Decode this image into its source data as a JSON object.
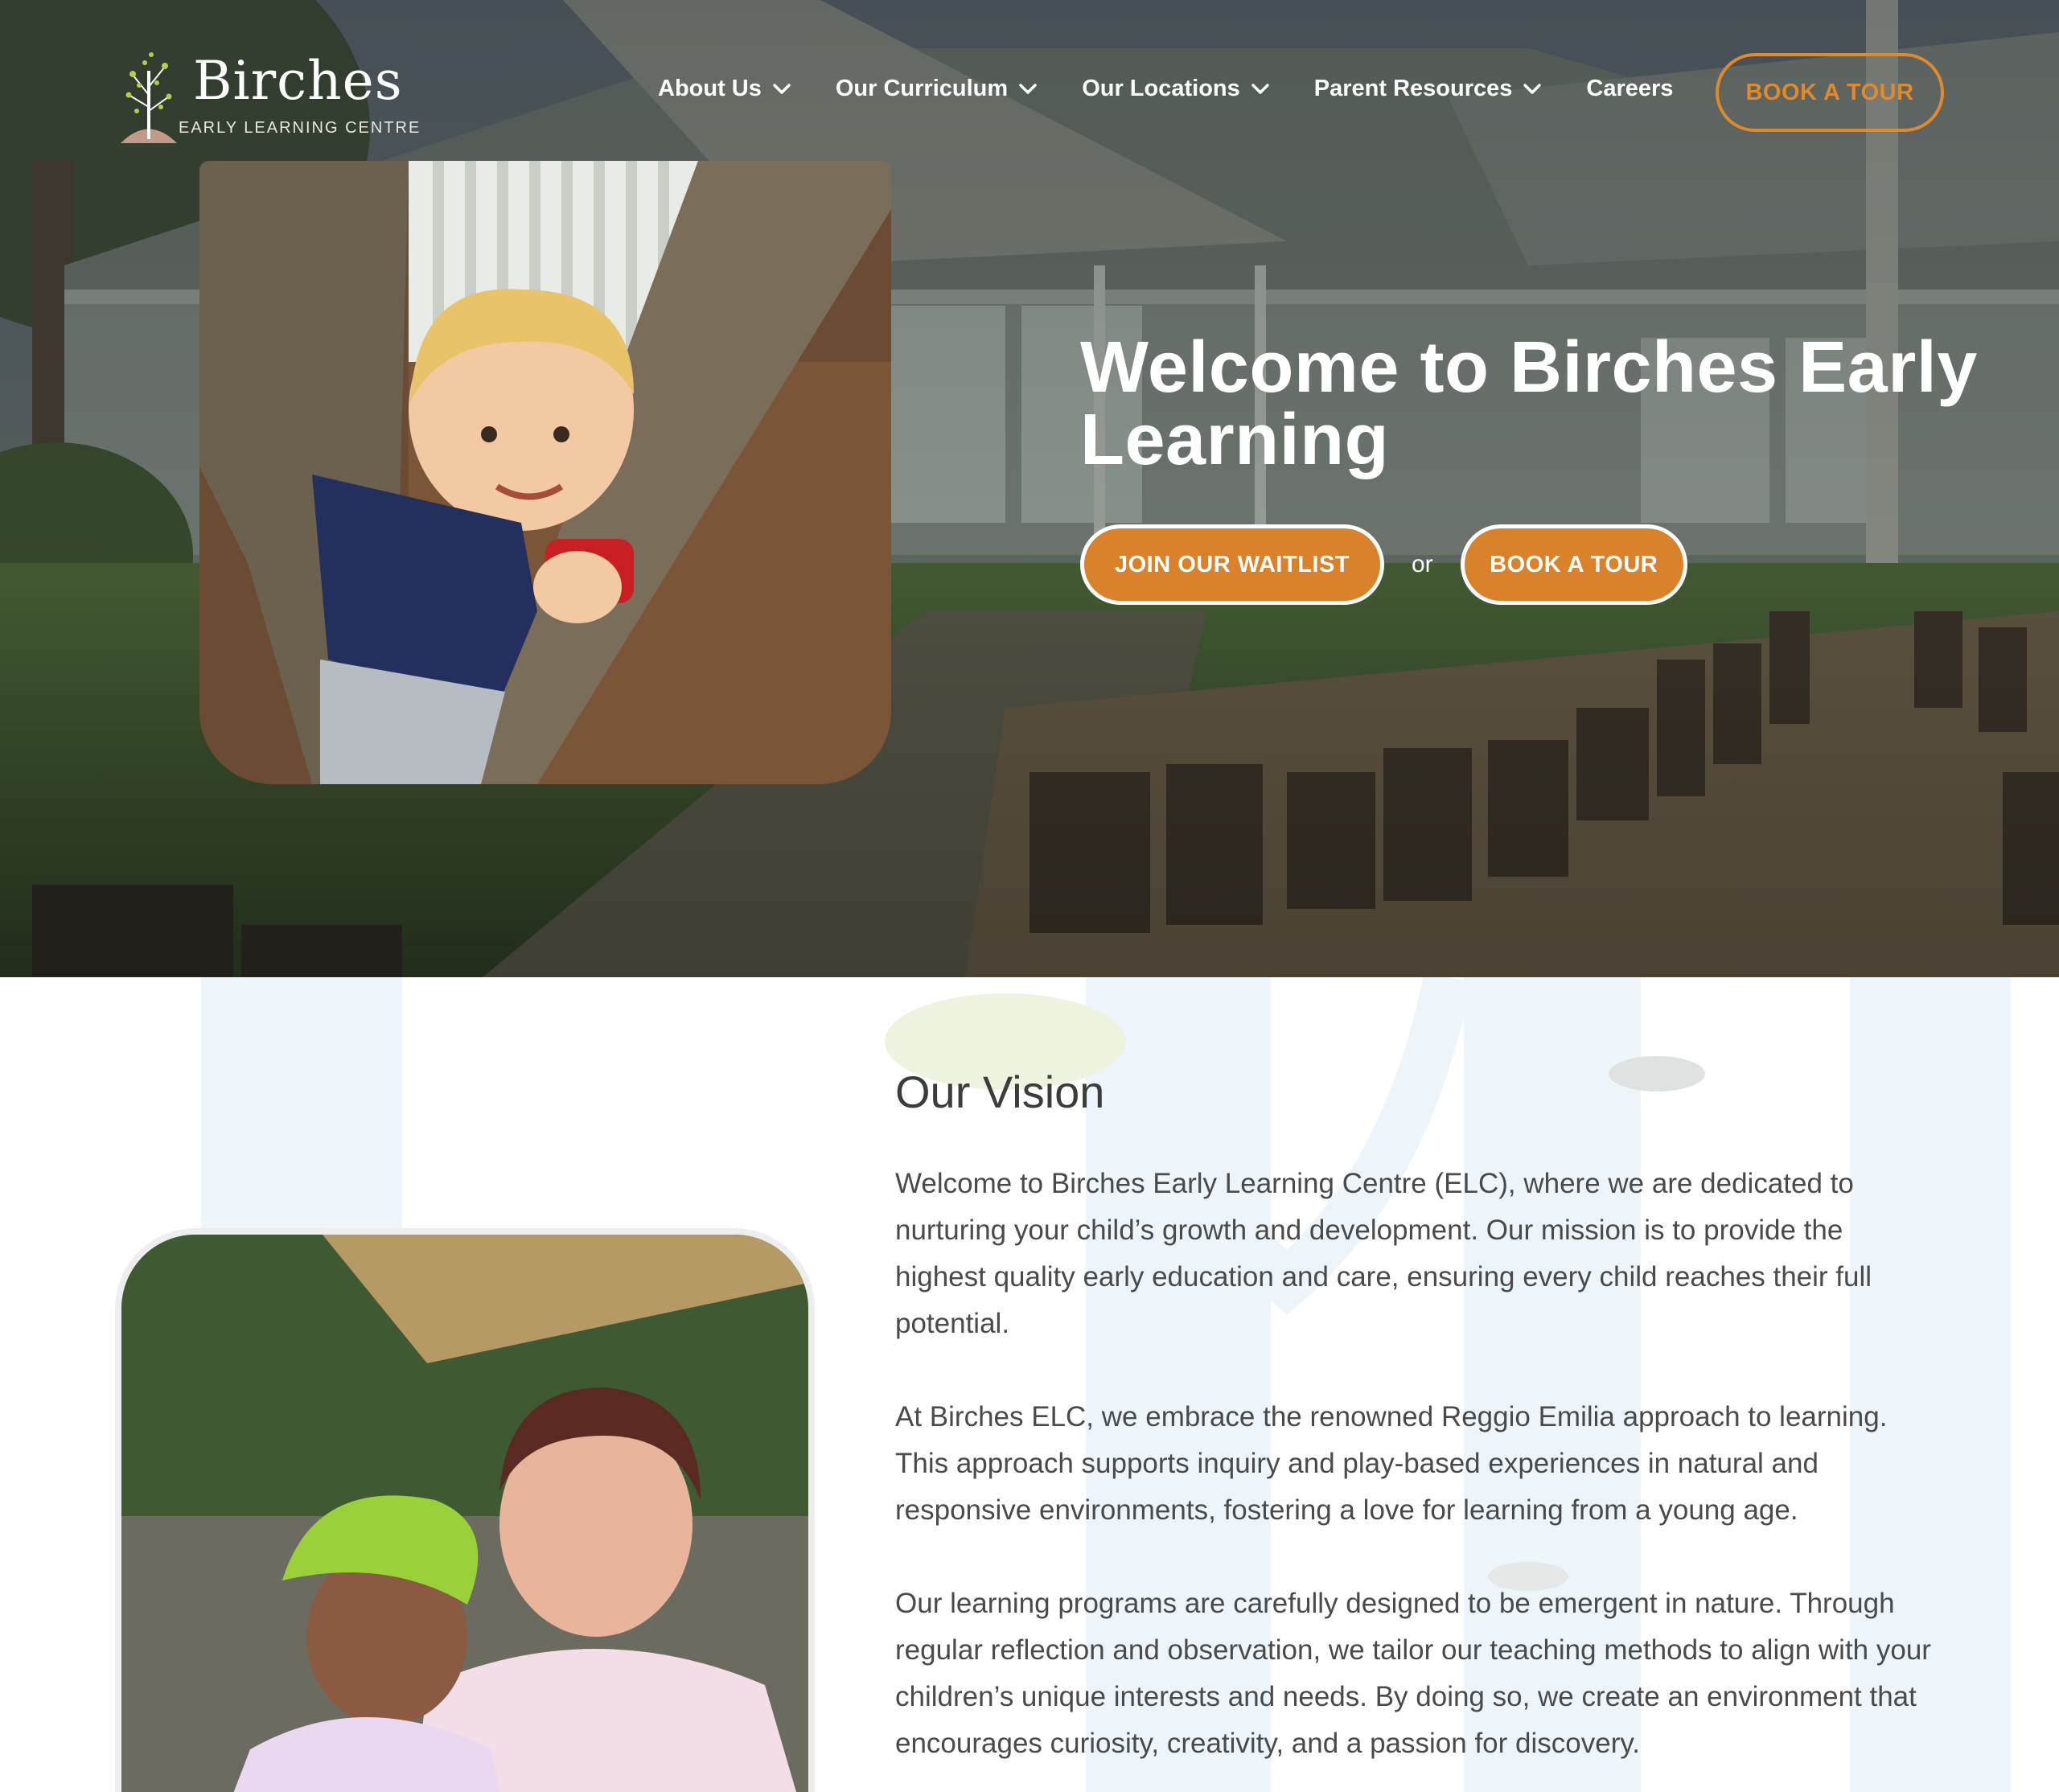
{
  "brand": {
    "name": "Birches",
    "tagline": "EARLY LEARNING CENTRE"
  },
  "nav": {
    "items": [
      {
        "label": "About Us",
        "has_dropdown": true
      },
      {
        "label": "Our Curriculum",
        "has_dropdown": true
      },
      {
        "label": "Our Locations",
        "has_dropdown": true
      },
      {
        "label": "Parent Resources",
        "has_dropdown": true
      },
      {
        "label": "Careers",
        "has_dropdown": false
      }
    ],
    "cta_label": "BOOK A TOUR"
  },
  "hero": {
    "title": "Welcome to Birches Early Learning",
    "waitlist_label": "JOIN OUR WAITLIST",
    "or_label": "or",
    "tour_label": "BOOK A TOUR"
  },
  "vision": {
    "heading": "Our Vision",
    "paragraphs": [
      "Welcome to Birches Early Learning Centre (ELC), where we are dedicated to nurturing your child’s growth and development. Our mission is to provide the highest quality early education and care, ensuring every child reaches their full potential.",
      "At Birches ELC, we embrace the renowned Reggio Emilia approach to learning. This approach supports inquiry and play-based experiences in natural and responsive environments, fostering a love for learning from a young age.",
      "Our learning programs are carefully designed to be emergent in nature. Through regular reflection and observation, we tailor our teaching methods to align with your children’s unique interests and needs. By doing so, we create an environment that encourages curiosity, creativity, and a passion for discovery."
    ]
  },
  "colors": {
    "accent": "#d9822b",
    "accent_outline": "#e08a2c",
    "text_dark": "#3a3d3a",
    "text_body": "#4a4a4a"
  },
  "icons": [
    "chevron-down-icon",
    "birch-tree-logo-icon"
  ]
}
